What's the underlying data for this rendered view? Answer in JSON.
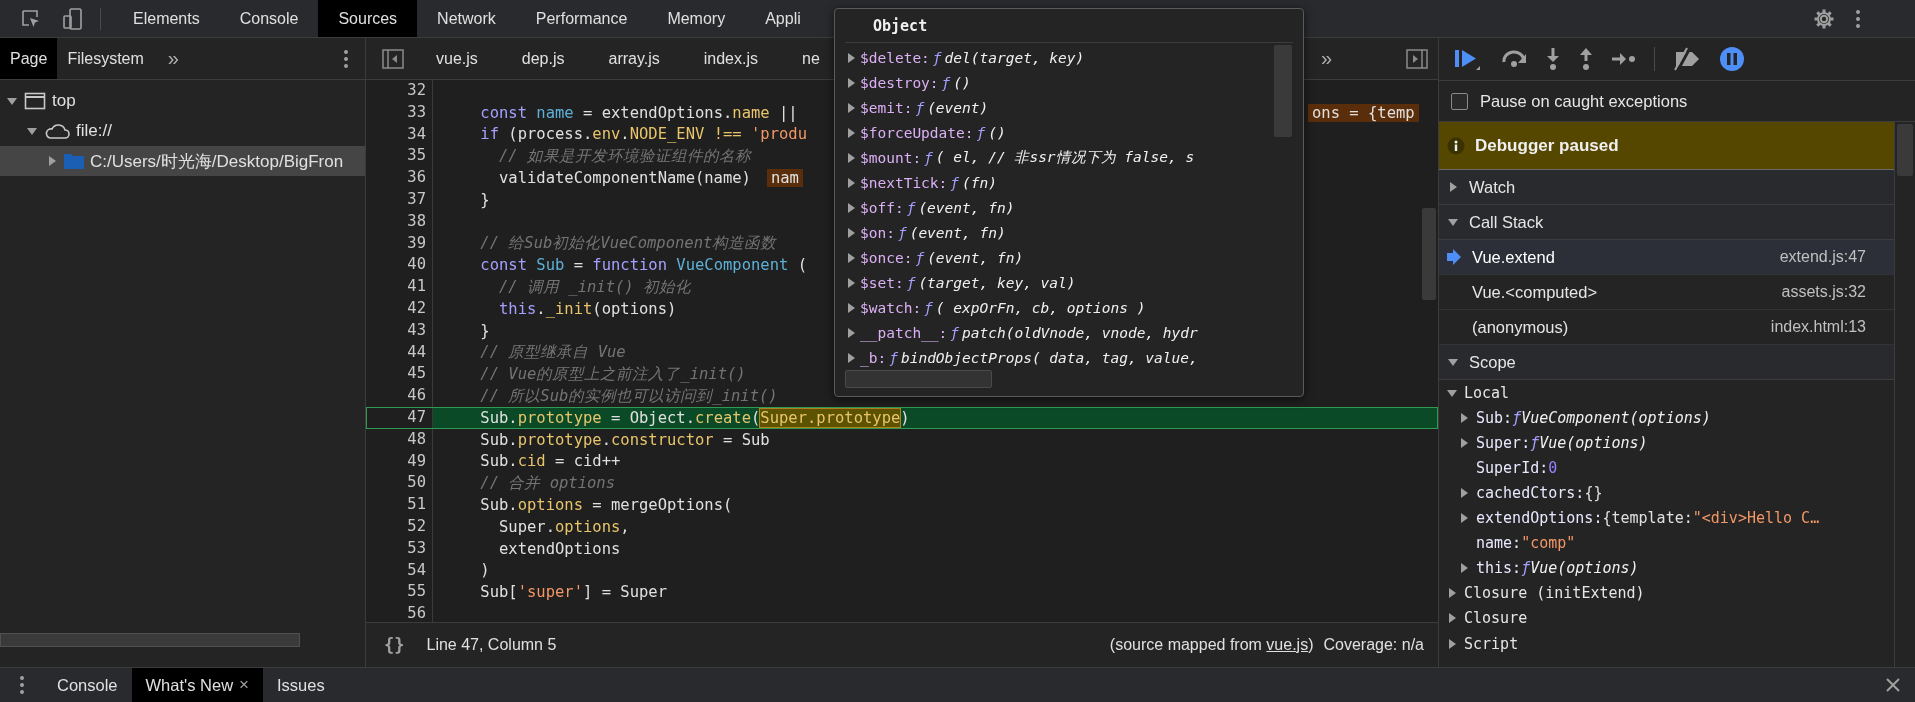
{
  "main_tabs": [
    {
      "label": "Elements",
      "selected": false
    },
    {
      "label": "Console",
      "selected": false
    },
    {
      "label": "Sources",
      "selected": true
    },
    {
      "label": "Network",
      "selected": false
    },
    {
      "label": "Performance",
      "selected": false
    },
    {
      "label": "Memory",
      "selected": false
    },
    {
      "label": "Appli",
      "selected": false
    }
  ],
  "navigator": {
    "tabs": [
      {
        "label": "Page",
        "selected": true
      },
      {
        "label": "Filesystem",
        "selected": false
      }
    ],
    "more": "»",
    "tree": [
      {
        "label": "top",
        "kind": "frame",
        "expanded": true,
        "selected": false,
        "children": [
          {
            "label": "file://",
            "kind": "origin",
            "expanded": true,
            "selected": false,
            "children": [
              {
                "label": "C:/Users/时光海/Desktop/BigFron",
                "kind": "folder",
                "expanded": false,
                "selected": true
              }
            ]
          }
        ]
      }
    ]
  },
  "editor": {
    "tabs": [
      "vue.js",
      "dep.js",
      "array.js",
      "index.js",
      "ne"
    ],
    "more": "»",
    "lines": [
      {
        "number": "32",
        "current": false
      },
      {
        "number": "33",
        "current": false,
        "tokens": [
          {
            "t": "    const ",
            "kind": "kw"
          },
          {
            "t": "name",
            "kind": "def"
          },
          {
            "t": " = extendOptions.",
            "kind": "plain"
          },
          {
            "t": "name",
            "kind": "prop"
          },
          {
            "t": " ||",
            "kind": "plain"
          }
        ],
        "inline_value": "ons = {temp"
      },
      {
        "number": "34",
        "current": false,
        "tokens": [
          {
            "t": "    if",
            "kind": "kw"
          },
          {
            "t": " (process.",
            "kind": "plain"
          },
          {
            "t": "env",
            "kind": "prop"
          },
          {
            "t": ".",
            "kind": "plain"
          },
          {
            "t": "NODE_ENV !== ",
            "kind": "prop"
          },
          {
            "t": "'produ",
            "kind": "str"
          }
        ]
      },
      {
        "number": "35",
        "current": false,
        "tokens": [
          {
            "t": "      // 如果是开发环境验证组件的名称",
            "kind": "com"
          }
        ]
      },
      {
        "number": "36",
        "current": false,
        "tokens": [
          {
            "t": "      validateComponentName(name)",
            "kind": "plain"
          }
        ],
        "value_chip": "nam"
      },
      {
        "number": "37",
        "current": false,
        "tokens": [
          {
            "t": "    }",
            "kind": "plain"
          }
        ]
      },
      {
        "number": "38",
        "current": false
      },
      {
        "number": "39",
        "current": false,
        "tokens": [
          {
            "t": "    // 给Sub初始化VueComponent构造函数",
            "kind": "com"
          }
        ]
      },
      {
        "number": "40",
        "current": false,
        "tokens": [
          {
            "t": "    const ",
            "kind": "kw"
          },
          {
            "t": "Sub",
            "kind": "def"
          },
          {
            "t": " = ",
            "kind": "plain"
          },
          {
            "t": "function ",
            "kind": "kw"
          },
          {
            "t": "VueComponent",
            "kind": "def"
          },
          {
            "t": " (",
            "kind": "plain"
          }
        ]
      },
      {
        "number": "41",
        "current": false,
        "tokens": [
          {
            "t": "      // 调用 _init() 初始化",
            "kind": "com"
          }
        ]
      },
      {
        "number": "42",
        "current": false,
        "tokens": [
          {
            "t": "      this",
            "kind": "kw"
          },
          {
            "t": ".",
            "kind": "plain"
          },
          {
            "t": "_init",
            "kind": "prop"
          },
          {
            "t": "(options)",
            "kind": "plain"
          }
        ]
      },
      {
        "number": "43",
        "current": false,
        "tokens": [
          {
            "t": "    }",
            "kind": "plain"
          }
        ]
      },
      {
        "number": "44",
        "current": false,
        "tokens": [
          {
            "t": "    // 原型继承自 Vue",
            "kind": "com"
          }
        ]
      },
      {
        "number": "45",
        "current": false,
        "tokens": [
          {
            "t": "    // Vue的原型上之前注入了_init()",
            "kind": "com"
          }
        ]
      },
      {
        "number": "46",
        "current": false,
        "tokens": [
          {
            "t": "    // 所以Sub的实例也可以访问到_init()",
            "kind": "com"
          }
        ]
      },
      {
        "number": "47",
        "current": true,
        "tokens": [
          {
            "t": "    Sub.",
            "kind": "plain"
          },
          {
            "t": "prototype",
            "kind": "prop"
          },
          {
            "t": " = Object.",
            "kind": "plain"
          },
          {
            "t": "create",
            "kind": "prop"
          },
          {
            "t": "(",
            "kind": "plain"
          },
          {
            "t": "Super.prototype",
            "kind": "match"
          },
          {
            "t": ")",
            "kind": "plain"
          }
        ]
      },
      {
        "number": "48",
        "current": false,
        "tokens": [
          {
            "t": "    Sub.",
            "kind": "plain"
          },
          {
            "t": "prototype",
            "kind": "prop"
          },
          {
            "t": ".",
            "kind": "plain"
          },
          {
            "t": "constructor",
            "kind": "prop"
          },
          {
            "t": " = Sub",
            "kind": "plain"
          }
        ]
      },
      {
        "number": "49",
        "current": false,
        "tokens": [
          {
            "t": "    Sub.",
            "kind": "plain"
          },
          {
            "t": "cid",
            "kind": "prop"
          },
          {
            "t": " = cid++",
            "kind": "plain"
          }
        ]
      },
      {
        "number": "50",
        "current": false,
        "tokens": [
          {
            "t": "    // 合并 options",
            "kind": "com"
          }
        ]
      },
      {
        "number": "51",
        "current": false,
        "tokens": [
          {
            "t": "    Sub.",
            "kind": "plain"
          },
          {
            "t": "options",
            "kind": "prop"
          },
          {
            "t": " = mergeOptions(",
            "kind": "plain"
          }
        ]
      },
      {
        "number": "52",
        "current": false,
        "tokens": [
          {
            "t": "      Super.",
            "kind": "plain"
          },
          {
            "t": "options",
            "kind": "prop"
          },
          {
            "t": ",",
            "kind": "plain"
          }
        ]
      },
      {
        "number": "53",
        "current": false,
        "tokens": [
          {
            "t": "      extendOptions",
            "kind": "plain"
          }
        ]
      },
      {
        "number": "54",
        "current": false,
        "tokens": [
          {
            "t": "    )",
            "kind": "plain"
          }
        ]
      },
      {
        "number": "55",
        "current": false,
        "tokens": [
          {
            "t": "    Sub[",
            "kind": "plain"
          },
          {
            "t": "'super'",
            "kind": "str"
          },
          {
            "t": "] = Super",
            "kind": "plain"
          }
        ]
      },
      {
        "number": "56",
        "current": false
      }
    ],
    "popover": {
      "title": "Object",
      "rows": [
        {
          "key": "$delete:",
          "f": "ƒ",
          "signature": "del(target, key)"
        },
        {
          "key": "$destroy:",
          "f": "ƒ",
          "signature": "()"
        },
        {
          "key": "$emit:",
          "f": "ƒ",
          "signature": "(event)"
        },
        {
          "key": "$forceUpdate:",
          "f": "ƒ",
          "signature": "()"
        },
        {
          "key": "$mount:",
          "f": "ƒ",
          "signature": "( el, // 非ssr情况下为 false, s"
        },
        {
          "key": "$nextTick:",
          "f": "ƒ",
          "signature": "(fn)"
        },
        {
          "key": "$off:",
          "f": "ƒ",
          "signature": "(event, fn)"
        },
        {
          "key": "$on:",
          "f": "ƒ",
          "signature": "(event, fn)"
        },
        {
          "key": "$once:",
          "f": "ƒ",
          "signature": "(event, fn)"
        },
        {
          "key": "$set:",
          "f": "ƒ",
          "signature": "(target, key, val)"
        },
        {
          "key": "$watch:",
          "f": "ƒ",
          "signature": "( expOrFn, cb, options )"
        },
        {
          "key": "__patch__:",
          "f": "ƒ",
          "signature": "patch(oldVnode, vnode, hydr"
        },
        {
          "key": "_b:",
          "f": "ƒ",
          "signature": "bindObjectProps( data, tag, value,"
        }
      ]
    }
  },
  "status_bar": {
    "format_button": "{}",
    "position": "Line 47, Column 5",
    "source_prefix": "(source mapped from ",
    "source_link": "vue.js",
    "source_suffix": ")",
    "coverage": "Coverage: n/a"
  },
  "debugger": {
    "pause_on_caught": {
      "label": "Pause on caught exceptions",
      "checked": false
    },
    "banner": "Debugger paused",
    "watch": {
      "title": "Watch",
      "expanded": false
    },
    "call_stack": {
      "title": "Call Stack",
      "expanded": true,
      "frames": [
        {
          "function": "Vue.extend",
          "location": "extend.js:47",
          "selected": true
        },
        {
          "function": "Vue.<computed>",
          "location": "assets.js:32",
          "selected": false
        },
        {
          "function": "(anonymous)",
          "location": "index.html:13",
          "selected": false
        }
      ]
    },
    "scope": {
      "title": "Scope",
      "expanded": true,
      "items": [
        {
          "label": "Local",
          "expanded": true,
          "children": [
            {
              "name": "Sub:",
              "kind": "expandable",
              "value": [
                {
                  "t": "ƒ",
                  "kind": "fn"
                },
                {
                  "t": "VueComponent(options)",
                  "kind": "it"
                }
              ]
            },
            {
              "name": "Super:",
              "kind": "expandable",
              "value": [
                {
                  "t": "ƒ",
                  "kind": "fn"
                },
                {
                  "t": "Vue(options)",
                  "kind": "it"
                }
              ]
            },
            {
              "name": "SuperId:",
              "kind": "leaf",
              "value": [
                {
                  "t": "0",
                  "kind": "num"
                }
              ]
            },
            {
              "name": "cachedCtors:",
              "kind": "expandable",
              "value": [
                {
                  "t": "{}",
                  "kind": "plain"
                }
              ]
            },
            {
              "name": "extendOptions:",
              "kind": "expandable",
              "value": [
                {
                  "t": "{template:",
                  "kind": "plain"
                },
                {
                  "t": "\"<div>Hello C…",
                  "kind": "str"
                }
              ]
            },
            {
              "name": "name:",
              "kind": "leaf",
              "value": [
                {
                  "t": "\"comp\"",
                  "kind": "str"
                }
              ]
            },
            {
              "name": "this:",
              "kind": "expandable",
              "value": [
                {
                  "t": "ƒ",
                  "kind": "fn"
                },
                {
                  "t": "Vue(options)",
                  "kind": "it"
                }
              ]
            }
          ]
        },
        {
          "label": "Closure (initExtend)",
          "expanded": false
        },
        {
          "label": "Closure",
          "expanded": false
        },
        {
          "label": "Script",
          "expanded": false
        }
      ]
    }
  },
  "drawer": {
    "tabs": [
      {
        "label": "Console",
        "selected": false,
        "closable": false
      },
      {
        "label": "What's New",
        "selected": true,
        "closable": true
      },
      {
        "label": "Issues",
        "selected": false,
        "closable": false
      }
    ],
    "close_glyph": "×"
  }
}
